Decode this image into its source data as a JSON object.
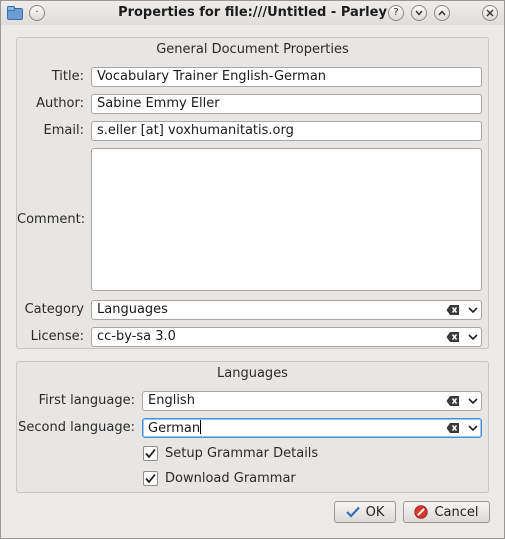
{
  "window": {
    "title": "Properties for file:///Untitled - Parley"
  },
  "titlebar_icons": [
    "app-folder-icon",
    "menu-icon",
    "help-icon",
    "minimize-icon",
    "maximize-icon",
    "close-icon"
  ],
  "general": {
    "heading": "General Document Properties",
    "title_label": "Title:",
    "title_value": "Vocabulary Trainer English-German",
    "author_label": "Author:",
    "author_value": "Sabine Emmy Eller",
    "email_label": "Email:",
    "email_value": "s.eller [at] voxhumanitatis.org",
    "comment_label": "Comment:",
    "comment_value": "",
    "category_label": "Category",
    "category_value": "Languages",
    "license_label": "License:",
    "license_value": "cc-by-sa 3.0"
  },
  "languages": {
    "heading": "Languages",
    "first_label": "First language:",
    "first_value": "English",
    "second_label": "Second language:",
    "second_value": "German",
    "setup_grammar_label": "Setup Grammar Details",
    "setup_grammar_checked": true,
    "download_grammar_label": "Download Grammar",
    "download_grammar_checked": true
  },
  "buttons": {
    "ok": "OK",
    "cancel": "Cancel"
  },
  "colors": {
    "focus": "#4a8ed6",
    "cancel_icon": "#d63a2e",
    "ok_icon": "#3b6fb5"
  }
}
